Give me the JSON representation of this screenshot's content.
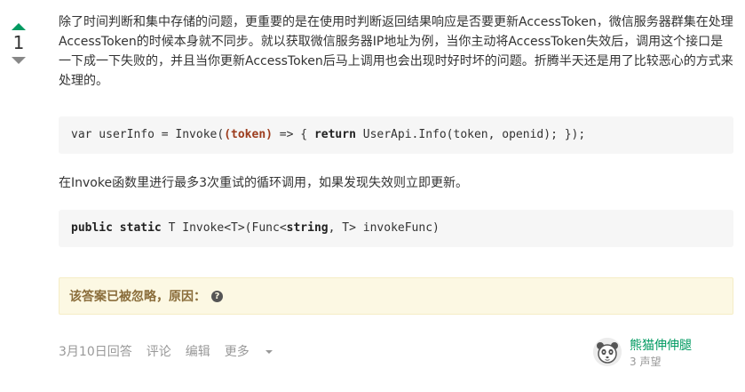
{
  "vote": {
    "count": "1"
  },
  "answer": {
    "paragraph1": "除了时间判断和集中存储的问题，更重要的是在使用时判断返回结果响应是否要更新AccessToken，微信服务器群集在处理AccessToken的时候本身就不同步。就以获取微信服务器IP地址为例，当你主动将AccessToken失效后，调用这个接口是一下成一下失败的，并且当你更新AccessToken后马上调用也会出现时好时坏的问题。折腾半天还是用了比较恶心的方式来处理的。",
    "code1": {
      "prefix": "var userInfo = Invoke(",
      "token": "(token)",
      "arrow": " => { ",
      "return_kw": "return",
      "suffix": " UserApi.Info(token, openid); });"
    },
    "paragraph2": "在Invoke函数里进行最多3次重试的循环调用，如果发现失效则立即更新。",
    "code2": {
      "kw1": "public",
      "kw2": "static",
      "mid": " T Invoke<T>(Func<",
      "kw3": "string",
      "suffix": ", T> invokeFunc)"
    }
  },
  "ignored_notice": {
    "text": "该答案已被忽略，原因：",
    "icon": "question-circle-icon",
    "icon_glyph": "?"
  },
  "footer": {
    "answered": "3月10日回答",
    "comment": "评论",
    "edit": "编辑",
    "more": "更多"
  },
  "user": {
    "name": "熊猫伸伸腿",
    "reputation": "3 声望"
  }
}
